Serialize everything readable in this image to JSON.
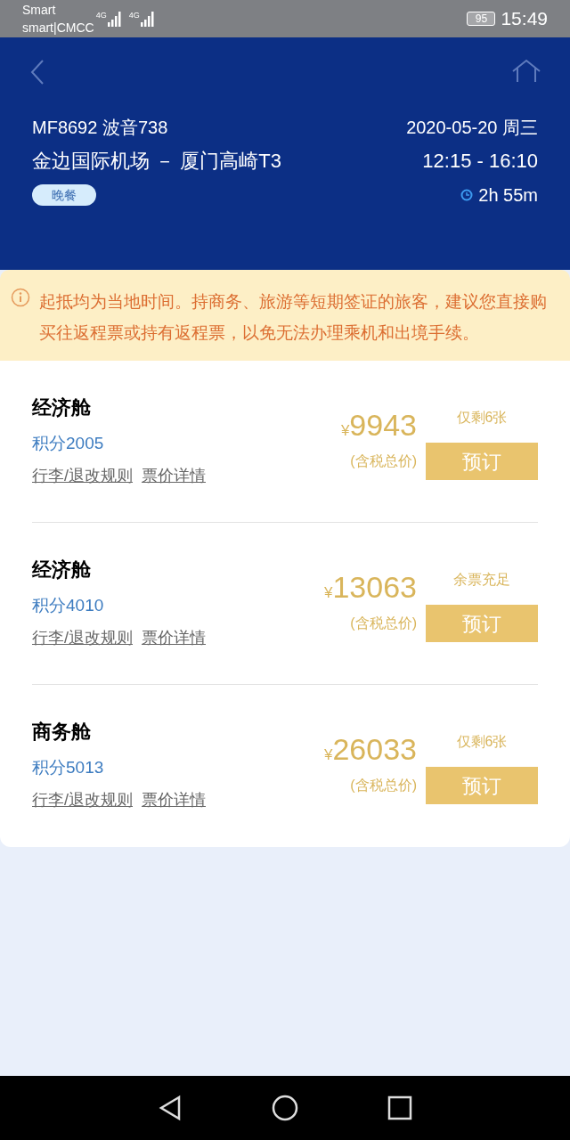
{
  "status_bar": {
    "carrier_1": "Smart",
    "carrier_2": "smart|CMCC",
    "networks": [
      "4G",
      "4G"
    ],
    "battery": "95",
    "time": "15:49"
  },
  "flight": {
    "number": "MF8692 波音738",
    "date": "2020-05-20 周三",
    "route": "金边国际机场 － 厦门高崎T3",
    "times": "12:15 - 16:10",
    "meal": "晚餐",
    "duration": "2h 55m"
  },
  "notice": "起抵均为当地时间。持商务、旅游等短期签证的旅客，建议您直接购买往返程票或持有返程票，以免无法办理乘机和出境手续。",
  "fares": [
    {
      "cabin": "经济舱",
      "points": "积分2005",
      "links": [
        "行李/退改规则",
        "票价详情"
      ],
      "currency": "¥",
      "price": "9943",
      "price_note": "(含税总价)",
      "availability": "仅剩6张",
      "button": "预订"
    },
    {
      "cabin": "经济舱",
      "points": "积分4010",
      "links": [
        "行李/退改规则",
        "票价详情"
      ],
      "currency": "¥",
      "price": "13063",
      "price_note": "(含税总价)",
      "availability": "余票充足",
      "button": "预订"
    },
    {
      "cabin": "商务舱",
      "points": "积分5013",
      "links": [
        "行李/退改规则",
        "票价详情"
      ],
      "currency": "¥",
      "price": "26033",
      "price_note": "(含税总价)",
      "availability": "仅剩6张",
      "button": "预订"
    }
  ]
}
